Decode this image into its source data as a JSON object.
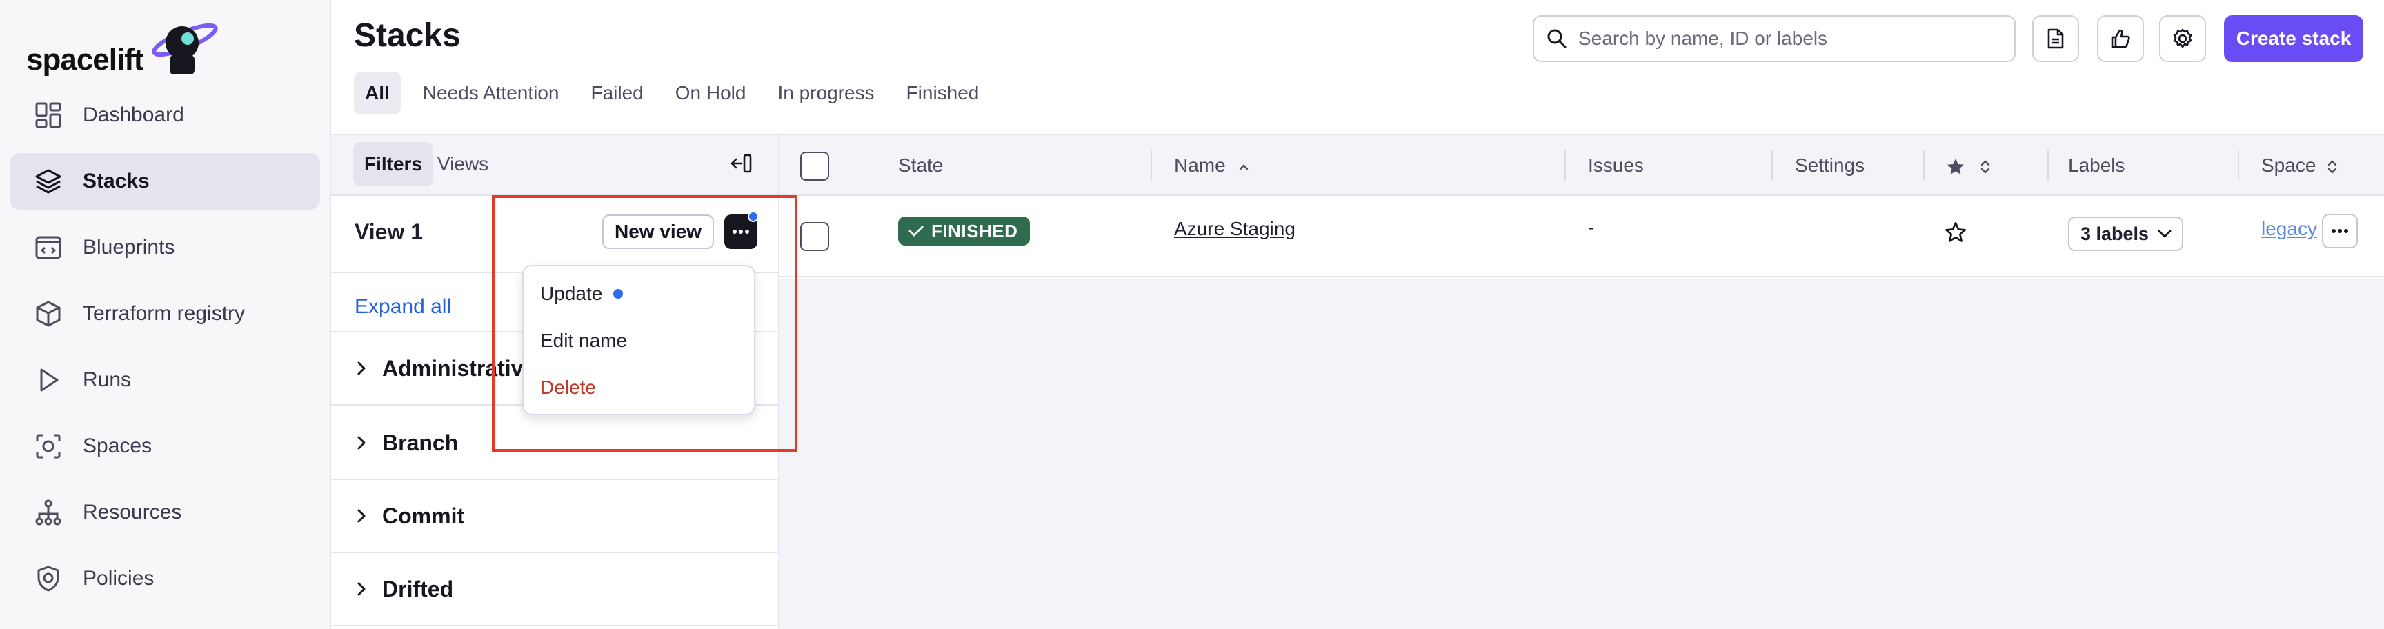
{
  "brand": {
    "logo_text": "spacelift"
  },
  "sidebar": {
    "items": [
      {
        "label": "Dashboard",
        "icon": "dashboard-icon"
      },
      {
        "label": "Stacks",
        "icon": "layers-icon",
        "active": true
      },
      {
        "label": "Blueprints",
        "icon": "blueprint-icon"
      },
      {
        "label": "Terraform registry",
        "icon": "cube-icon"
      },
      {
        "label": "Runs",
        "icon": "play-icon"
      },
      {
        "label": "Spaces",
        "icon": "space-icon"
      },
      {
        "label": "Resources",
        "icon": "hierarchy-icon"
      },
      {
        "label": "Policies",
        "icon": "shield-icon"
      }
    ]
  },
  "header": {
    "title": "Stacks",
    "search_placeholder": "Search by name, ID or labels",
    "create_label": "Create stack"
  },
  "tabs": [
    {
      "label": "All",
      "active": true
    },
    {
      "label": "Needs Attention"
    },
    {
      "label": "Failed"
    },
    {
      "label": "On Hold"
    },
    {
      "label": "In progress"
    },
    {
      "label": "Finished"
    }
  ],
  "filter_panel": {
    "tabs": [
      "Filters",
      "Views"
    ],
    "view_name": "View 1",
    "new_view_label": "New view",
    "expand_all": "Expand all",
    "groups": [
      "Administrative",
      "Branch",
      "Commit",
      "Drifted"
    ]
  },
  "menu": {
    "items": [
      {
        "label": "Update",
        "has_dot": true
      },
      {
        "label": "Edit name"
      },
      {
        "label": "Delete",
        "danger": true
      }
    ]
  },
  "table": {
    "columns": [
      "State",
      "Name",
      "Issues",
      "Settings",
      "Labels",
      "Space"
    ],
    "rows": [
      {
        "state": "FINISHED",
        "name": "Azure Staging",
        "issues": "-",
        "labels": "3 labels",
        "space": "legacy"
      }
    ]
  },
  "colors": {
    "accent": "#6a4cf5",
    "finished": "#2e6b4f",
    "link": "#2462d9",
    "danger": "#c0392b",
    "highlight": "#e43a2a"
  }
}
